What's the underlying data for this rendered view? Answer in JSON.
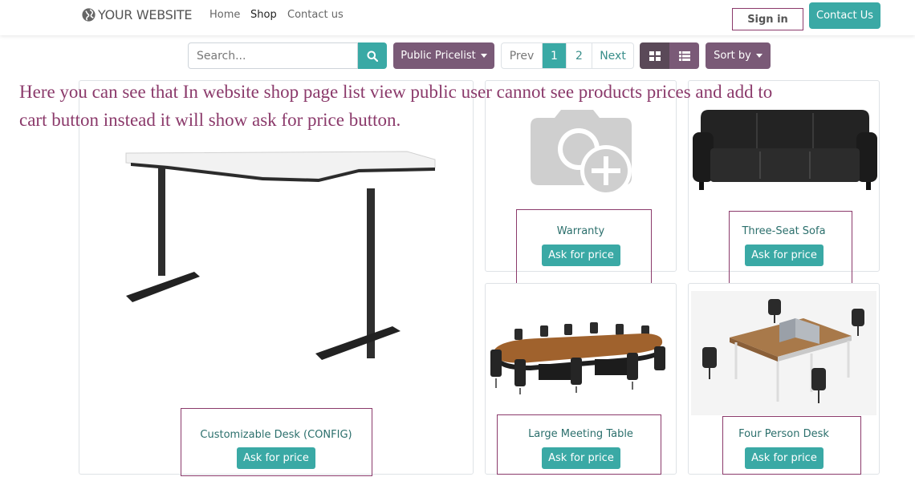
{
  "header": {
    "logo_text": "YOUR WEBSITE",
    "nav": [
      {
        "label": "Home",
        "active": false
      },
      {
        "label": "Shop",
        "active": true
      },
      {
        "label": "Contact us",
        "active": false
      }
    ],
    "signin_label": "Sign in",
    "contact_button_label": "Contact Us"
  },
  "toolbar": {
    "search_placeholder": "Search...",
    "search_icon": "search-icon",
    "pricelist_label": "Public Pricelist",
    "pager": {
      "prev": "Prev",
      "pages": [
        "1",
        "2"
      ],
      "active_page": "1",
      "next": "Next"
    },
    "view_grid_icon": "grid-view-icon",
    "view_list_icon": "list-view-icon",
    "sortby_label": "Sort by"
  },
  "annotation": "Here you can see that In website shop page list view public user cannot see products prices and add to cart button instead it will show ask for price button.",
  "products": [
    {
      "name": "Customizable Desk (CONFIG)",
      "button": "Ask for price",
      "image": "corner-desk"
    },
    {
      "name": "Warranty",
      "button": "Ask for price",
      "image": "camera-placeholder"
    },
    {
      "name": "Three-Seat Sofa",
      "button": "Ask for price",
      "image": "sofa"
    },
    {
      "name": "Large Meeting Table",
      "button": "Ask for price",
      "image": "meeting-table"
    },
    {
      "name": "Four Person Desk",
      "button": "Ask for price",
      "image": "office-desk"
    }
  ],
  "colors": {
    "accent_teal": "#3aa9a5",
    "secondary_plum": "#7a5a77",
    "highlight_border": "#8b3a6b",
    "annotation_text": "#8b3a6b"
  }
}
